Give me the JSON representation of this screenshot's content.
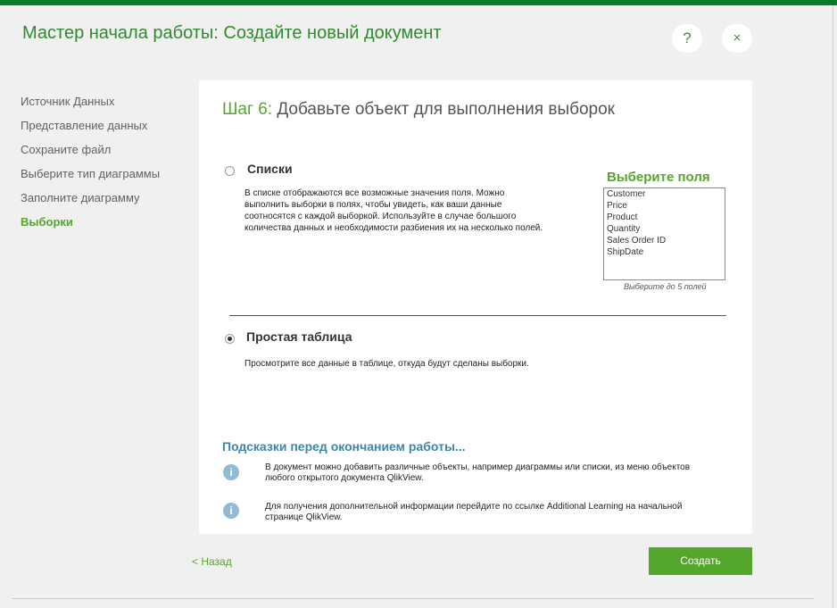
{
  "header": {
    "title": "Мастер начала работы: Создайте новый документ",
    "help_label": "?",
    "close_label": "×"
  },
  "sidebar": {
    "items": [
      {
        "label": "Источник Данных"
      },
      {
        "label": "Представление данных"
      },
      {
        "label": "Сохраните файл"
      },
      {
        "label": "Выберите тип диаграммы"
      },
      {
        "label": "Заполните диаграмму"
      },
      {
        "label": "Выборки",
        "active": true
      }
    ]
  },
  "step": {
    "number": "Шаг 6:",
    "title": "Добавьте объект для выполнения выборок"
  },
  "options": {
    "lists": {
      "title": "Списки",
      "checked": false,
      "description": [
        "В списке отображаются все возможные значения поля. Можно",
        "выполнить выборки в полях, чтобы увидеть, как ваши данные",
        "соотносятся с каждой выборкой. Используйте в случае большого",
        "количества данных и необходимости разбиения их на несколько полей."
      ]
    },
    "table": {
      "title": "Простая таблица",
      "checked": true,
      "description": "Просмотрите все данные в таблице, откуда будут сделаны выборки."
    }
  },
  "fields": {
    "title": "Выберите поля",
    "items": [
      "Customer",
      "Price",
      "Product",
      "Quantity",
      "Sales Order ID",
      "ShipDate"
    ],
    "hint": "Выберите до 5 полей"
  },
  "tips": {
    "title": "Подсказки перед окончанием работы...",
    "items": [
      {
        "icon": "info-icon",
        "lines": [
          "В документ можно добавить различные объекты, например диаграммы или списки, из меню объектов",
          "любого открытого документа QlikView."
        ]
      },
      {
        "icon": "info-icon",
        "lines": [
          "Для получения дополнительной информации перейдите по ссылке Additional Learning на начальной",
          "странице QlikView."
        ]
      }
    ]
  },
  "footer": {
    "back_label": "< Назад",
    "create_label": "Создать"
  },
  "colors": {
    "accent_green": "#55a62d",
    "top_bar": "#0a7a27",
    "tips_blue": "#3d86a8",
    "info_icon": "#8fbcd4"
  }
}
